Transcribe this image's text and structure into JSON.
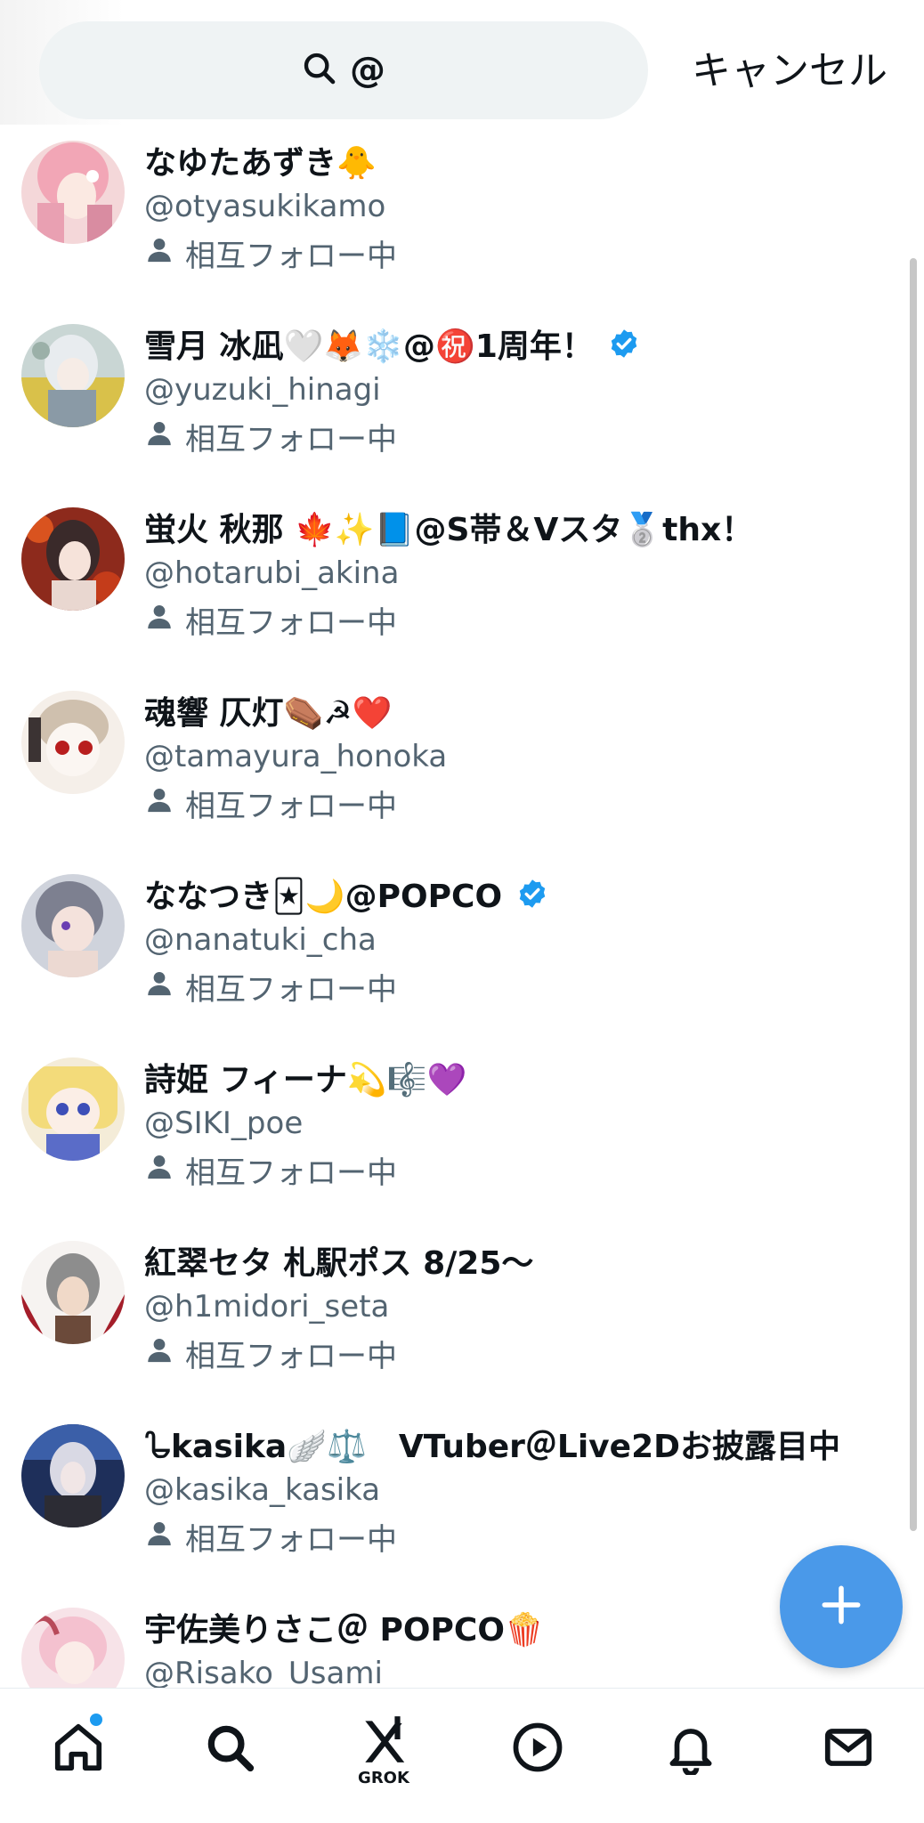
{
  "search": {
    "query": "@",
    "cancel_label": "キャンセル"
  },
  "colors": {
    "accent": "#1d9bf0",
    "fab": "#4a99e9",
    "secondary_text": "#536471"
  },
  "users": [
    {
      "name": "なゆたあずき🐥",
      "handle": "@otyasukikamo",
      "status": "相互フォロー中",
      "verified": false
    },
    {
      "name": "雪月 冰凪🤍🦊❄️@㊗️1周年！",
      "handle": "@yuzuki_hinagi",
      "status": "相互フォロー中",
      "verified": true
    },
    {
      "name": "蛍火 秋那 🍁✨📘@S帯＆Vスタ🥈thx！",
      "handle": "@hotarubi_akina",
      "status": "相互フォロー中",
      "verified": false
    },
    {
      "name": "魂響 仄灯⚰️☭❤️",
      "handle": "@tamayura_honoka",
      "status": "相互フォロー中",
      "verified": false
    },
    {
      "name": "ななつき🃏🌙@POPCO",
      "handle": "@nanatuki_cha",
      "status": "相互フォロー中",
      "verified": true
    },
    {
      "name": "詩姫 フィーナ💫🎼💜",
      "handle": "@SIKI_poe",
      "status": "相互フォロー中",
      "verified": false
    },
    {
      "name": "紅翠セタ 札駅ポス 8/25～",
      "handle": "@h1midori_seta",
      "status": "相互フォロー中",
      "verified": false
    },
    {
      "name": "𐃸kasika🪽⚖️　VTuber＠Live2Dお披露目中",
      "handle": "@kasika_kasika",
      "status": "相互フォロー中",
      "verified": false
    },
    {
      "name": "宇佐美りさこ＠ POPCO🍿",
      "handle": "@Risako_Usami",
      "status": "",
      "verified": false
    }
  ],
  "nav": {
    "items": [
      "home-icon",
      "search-icon",
      "grok-icon",
      "video-icon",
      "notifications-icon",
      "messages-icon"
    ],
    "grok_label": "GROK"
  }
}
